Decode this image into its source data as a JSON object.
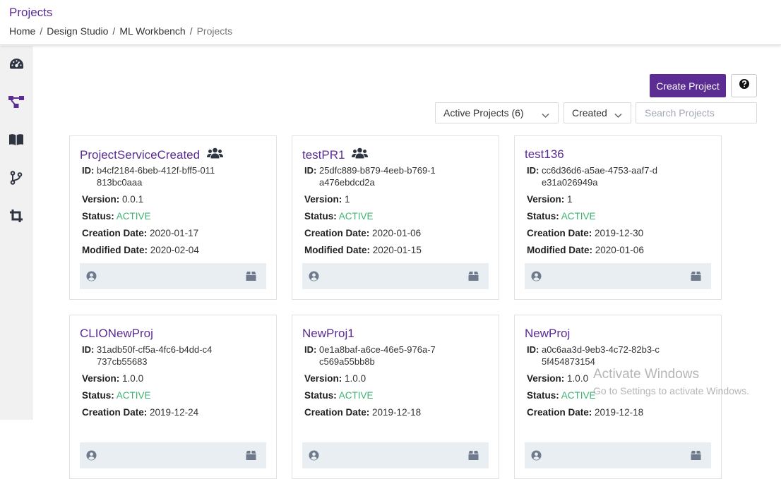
{
  "header": {
    "title": "Projects",
    "breadcrumb": [
      "Home",
      "Design Studio",
      "ML Workbench",
      "Projects"
    ],
    "separator": "/"
  },
  "sidebar": {
    "items": [
      {
        "icon": "dashboard-gauge-icon",
        "active": false
      },
      {
        "icon": "workflow-diagram-icon",
        "active": true
      },
      {
        "icon": "open-book-icon",
        "active": false
      },
      {
        "icon": "git-branch-icon",
        "active": false
      },
      {
        "icon": "crop-icon",
        "active": false
      }
    ]
  },
  "toolbar": {
    "create_label": "Create Project",
    "help_icon": "question-circle-icon",
    "filter_value": "Active Projects (6)",
    "sort_value": "Created",
    "search_placeholder": "Search Projects"
  },
  "labels": {
    "id": "ID:",
    "version": "Version:",
    "status": "Status:",
    "created": "Creation Date:",
    "modified": "Modified Date:"
  },
  "projects": [
    {
      "name": "ProjectServiceCreated",
      "shared": true,
      "id": "b4cf2184-6beb-412f-bff5-011813bc0aaa",
      "version": "0.0.1",
      "status": "ACTIVE",
      "created": "2020-01-17",
      "modified": "2020-02-04"
    },
    {
      "name": "testPR1",
      "shared": true,
      "id": "25dfc889-b879-4eeb-b769-1a476ebdcd2a",
      "version": "1",
      "status": "ACTIVE",
      "created": "2020-01-06",
      "modified": "2020-01-15"
    },
    {
      "name": "test136",
      "shared": false,
      "id": "cc6d36d6-a5ae-4753-aaf7-de31a026949a",
      "version": "1",
      "status": "ACTIVE",
      "created": "2019-12-30",
      "modified": "2020-01-06"
    },
    {
      "name": "CLIONewProj",
      "shared": false,
      "id": "31adb50f-cf5a-4fc6-b4dd-c4737cb55683",
      "version": "1.0.0",
      "status": "ACTIVE",
      "created": "2019-12-24",
      "modified": ""
    },
    {
      "name": "NewProj1",
      "shared": false,
      "id": "0e1a8baf-a6ce-46e5-976a-7c569a55bb8b",
      "version": "1.0.0",
      "status": "ACTIVE",
      "created": "2019-12-18",
      "modified": ""
    },
    {
      "name": "NewProj",
      "shared": false,
      "id": "a0c6aa3d-9eb3-4c72-82b3-c5f454873154",
      "version": "1.0.0",
      "status": "ACTIVE",
      "created": "2019-12-18",
      "modified": ""
    }
  ],
  "watermark": {
    "line1": "Activate Windows",
    "line2": "Go to Settings to activate Windows."
  },
  "colors": {
    "brand": "#5b2c91",
    "status_active": "#3cb371",
    "footer_bg": "#e9eef3",
    "sidebar_bg": "#f1f1f1"
  }
}
